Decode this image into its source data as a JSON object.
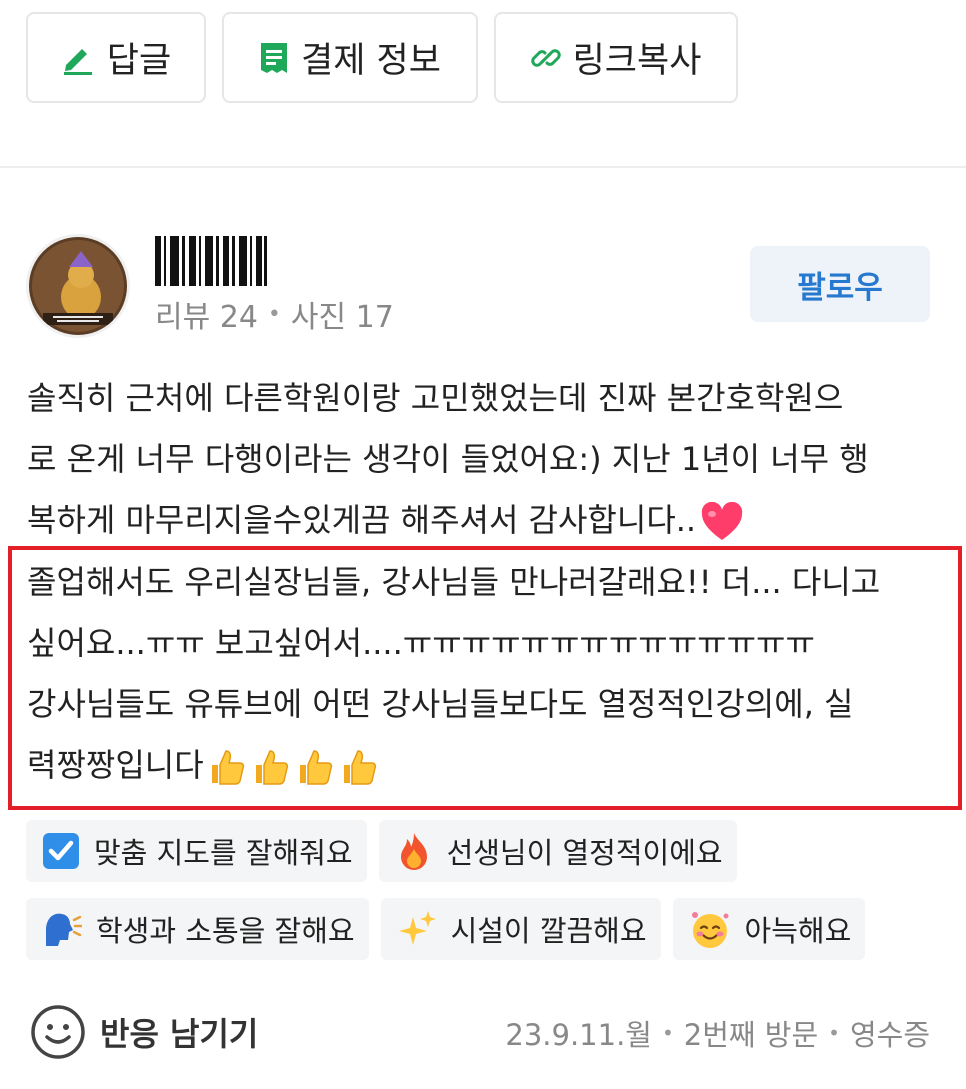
{
  "actions": {
    "reply_label": "답글",
    "payment_label": "결제 정보",
    "link_label": "링크복사"
  },
  "profile": {
    "reviews": "리뷰 24",
    "photos": "사진 17",
    "stat_separator": "•",
    "follow_label": "팔로우"
  },
  "review": {
    "lines": [
      "솔직히 근처에 다른학원이랑 고민했었는데 진짜 본간호학원으",
      "로 온게 너무 다행이라는 생각이 들었어요:) 지난 1년이 너무 행",
      "복하게 마무리지을수있게끔 해주셔서 감사합니다.."
    ],
    "highlighted_lines": [
      "졸업해서도 우리실장님들, 강사님들 만나러갈래요!! 더... 다니고",
      "싶어요...ㅠㅠ 보고싶어서....ㅠㅠㅠㅠㅠㅠㅠㅠㅠㅠㅠㅠㅠㅠ",
      "강사님들도 유튜브에 어떤 강사님들보다도 열정적인강의에, 실",
      "력짱짱입니다"
    ]
  },
  "tags": [
    {
      "icon": "check-box-icon",
      "label": "맞춤 지도를 잘해줘요"
    },
    {
      "icon": "fire-icon",
      "label": "선생님이 열정적이에요"
    },
    {
      "icon": "speaking-head-icon",
      "label": "학생과 소통을 잘해요"
    },
    {
      "icon": "sparkles-icon",
      "label": "시설이 깔끔해요"
    },
    {
      "icon": "smiling-face-icon",
      "label": "아늑해요"
    }
  ],
  "footer": {
    "react_label": "반응 남기기",
    "date": "23.9.11.월",
    "visit": "2번째 방문",
    "receipt": "영수증",
    "separator": "•"
  },
  "colors": {
    "accent_green": "#1fa85a",
    "follow_blue": "#2779cf",
    "highlight_red": "#e32028"
  }
}
